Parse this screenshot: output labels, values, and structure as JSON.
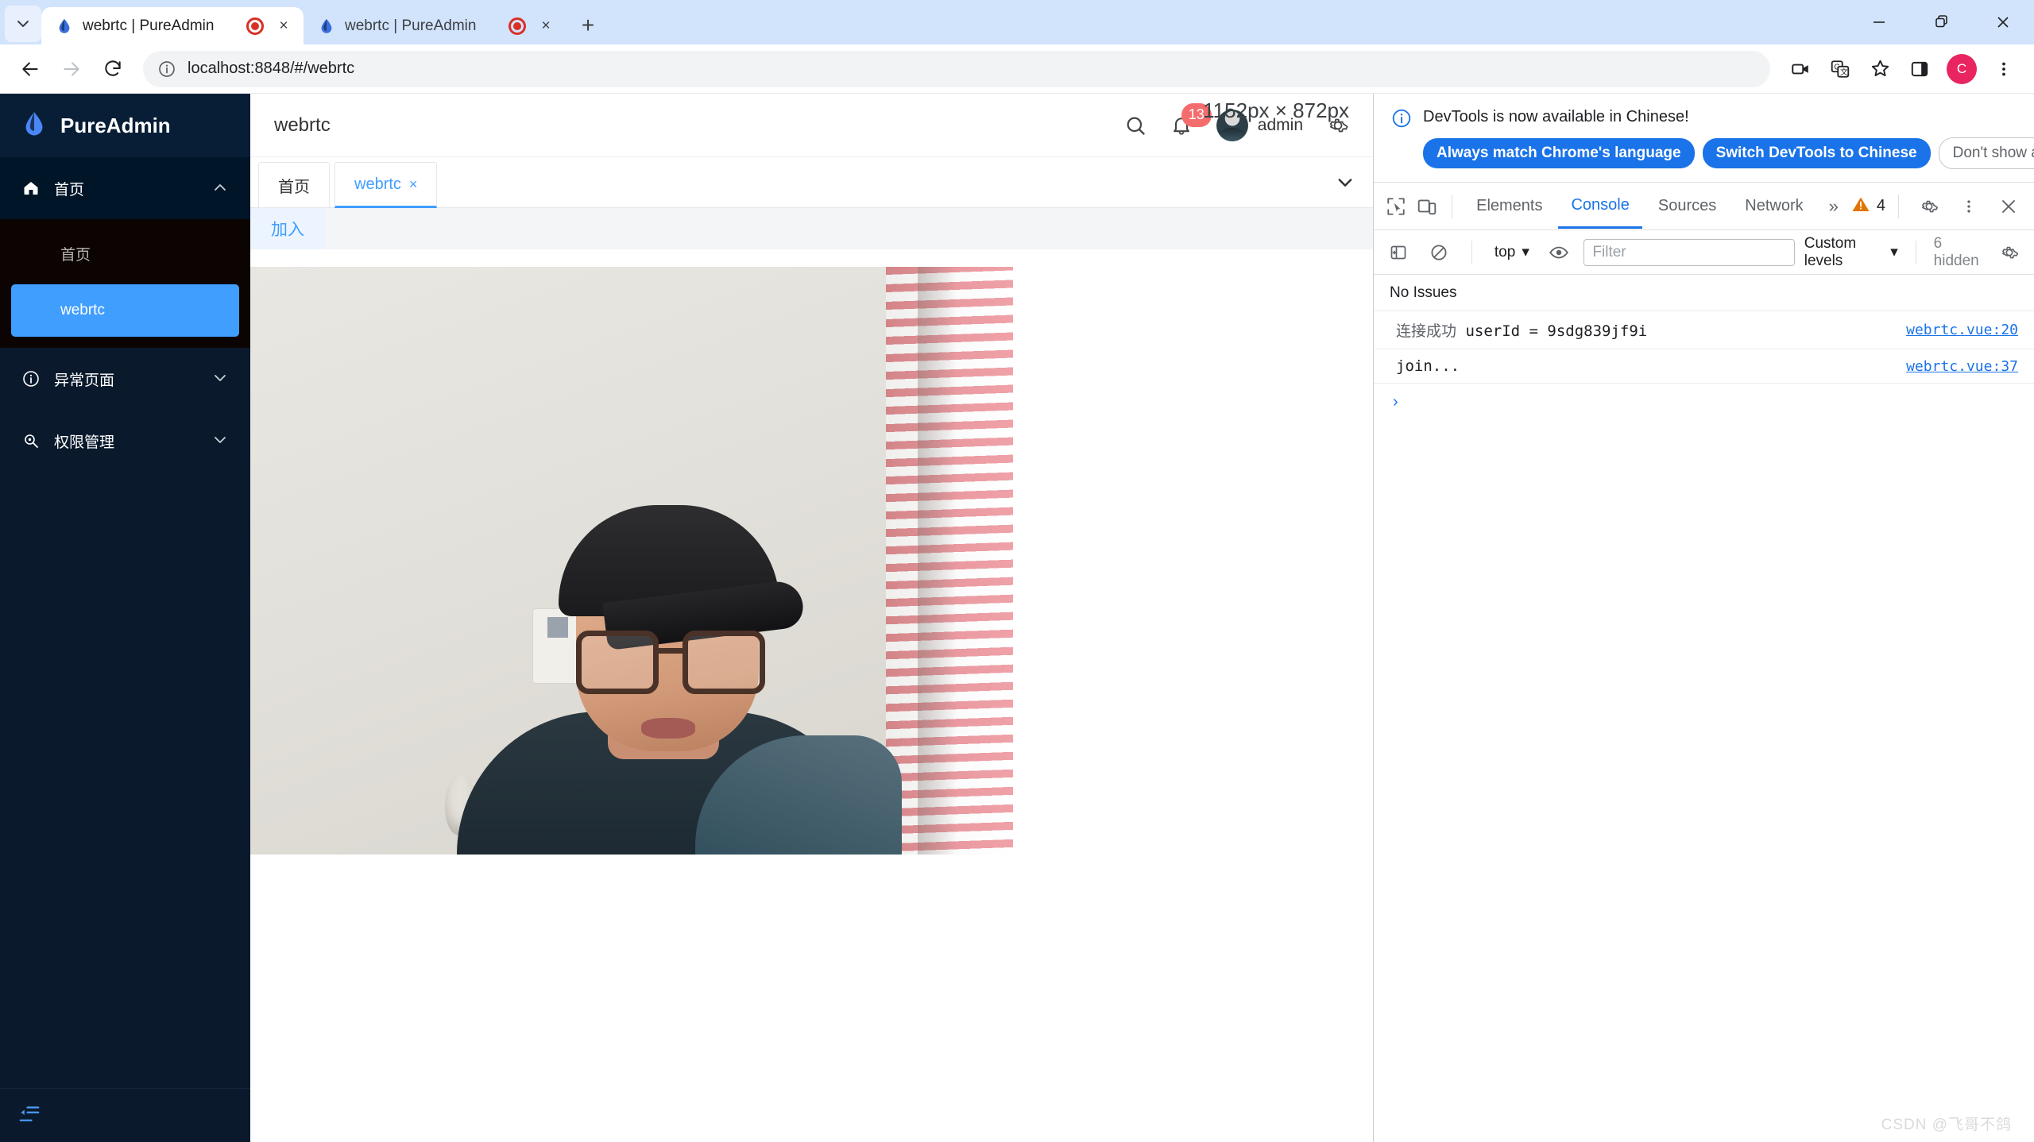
{
  "browser": {
    "tab_search_icon": "chevron-down-icon",
    "tabs": [
      {
        "title": "webrtc | PureAdmin",
        "favicon": "droplet-icon",
        "recording": true,
        "close": "×",
        "active": true
      },
      {
        "title": "webrtc | PureAdmin",
        "favicon": "droplet-icon",
        "recording": true,
        "close": "×",
        "active": false
      }
    ],
    "new_tab_label": "+",
    "window_controls": {
      "minimize": "–",
      "maximize": "❐",
      "close": "✕"
    },
    "nav": {
      "back": "←",
      "forward": "→",
      "reload": "↻"
    },
    "omnibox": {
      "site_info_icon": "info-circle-icon",
      "url": "localhost:8848/#/webrtc"
    },
    "actions": {
      "media_icon": "video-camera-icon",
      "translate_icon": "google-translate-icon",
      "bookmark_icon": "star-icon",
      "side_panel_icon": "side-panel-icon",
      "profile_initial": "C",
      "menu_icon": "kebab-menu-icon"
    }
  },
  "app": {
    "logo_text": "PureAdmin",
    "logo_icon": "droplet-logo-icon",
    "sidebar": {
      "groups": [
        {
          "label": "首页",
          "icon": "home-icon",
          "expanded": true,
          "chevron": "chevron-up-icon",
          "children": [
            {
              "label": "首页",
              "active": false
            },
            {
              "label": "webrtc",
              "active": true
            }
          ]
        },
        {
          "label": "异常页面",
          "icon": "info-circle-icon",
          "expanded": false,
          "chevron": "chevron-down-icon",
          "children": []
        },
        {
          "label": "权限管理",
          "icon": "magnifier-icon",
          "expanded": false,
          "chevron": "chevron-down-icon",
          "children": []
        }
      ],
      "collapse_icon": "collapse-sidebar-icon"
    },
    "header": {
      "page_title": "webrtc",
      "search_icon": "search-icon",
      "bell_icon": "bell-icon",
      "notification_count": "13",
      "avatar": "user-avatar",
      "user_name": "admin",
      "settings_icon": "gear-icon",
      "resize_overlay": "1152px × 872px"
    },
    "page_tabs": {
      "items": [
        {
          "label": "首页",
          "active": false,
          "closable": false
        },
        {
          "label": "webrtc",
          "active": true,
          "closable": true,
          "close": "×"
        }
      ],
      "dropdown_icon": "chevron-down-icon"
    },
    "content": {
      "join_button": "加入",
      "video_alt": "local-webcam-stream"
    }
  },
  "devtools": {
    "banner": {
      "icon": "info-circle-icon",
      "text": "DevTools is now available in Chinese!",
      "buttons": [
        {
          "label": "Always match Chrome's language",
          "style": "primary"
        },
        {
          "label": "Switch DevTools to Chinese",
          "style": "primary"
        },
        {
          "label": "Don't show again",
          "style": "ghost"
        }
      ],
      "close": "✕"
    },
    "toolbar": {
      "inspect_icon": "inspect-element-icon",
      "device_icon": "device-toolbar-icon",
      "tabs": [
        {
          "label": "Elements",
          "active": false
        },
        {
          "label": "Console",
          "active": true
        },
        {
          "label": "Sources",
          "active": false
        },
        {
          "label": "Network",
          "active": false
        }
      ],
      "more_tabs_icon": "»",
      "warning_icon": "warning-triangle-icon",
      "warning_count": "4",
      "settings_icon": "gear-icon",
      "menu_icon": "kebab-menu-icon",
      "close_icon": "✕"
    },
    "console_bar": {
      "sidebar_icon": "console-sidebar-icon",
      "clear_icon": "clear-console-icon",
      "context": "top",
      "context_chevron": "▾",
      "eye_icon": "live-expression-icon",
      "filter_placeholder": "Filter",
      "filter_value": "",
      "levels_label": "Custom levels",
      "levels_chevron": "▾",
      "hidden_label": "6 hidden",
      "settings_icon": "gear-icon"
    },
    "issues_label": "No Issues",
    "messages": [
      {
        "text_cn": "连接成功",
        "text_mono": " userId = 9sdg839jf9i",
        "source": "webrtc.vue:20"
      },
      {
        "text_cn": "",
        "text_mono": "join...",
        "source": "webrtc.vue:37"
      }
    ],
    "prompt": "›"
  },
  "watermark": "CSDN @飞哥不鸽",
  "colors": {
    "chrome_tabstrip": "#d2e3fc",
    "sidebar_bg": "#0a1a2c",
    "accent_blue": "#409eff",
    "devtools_blue": "#1a73e8",
    "badge_red": "#f56c6c",
    "profile_pink": "#e8255f"
  }
}
